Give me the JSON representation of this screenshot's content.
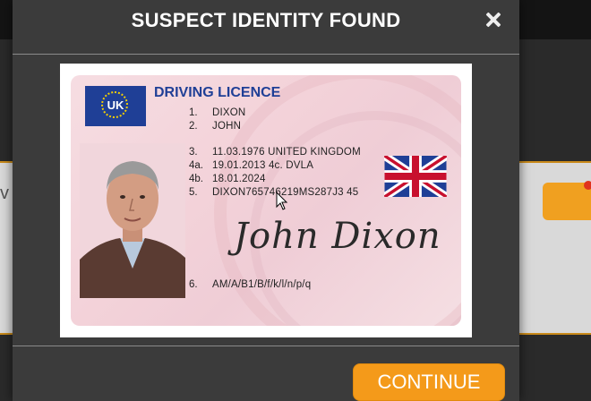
{
  "modal": {
    "title": "SUSPECT IDENTITY FOUND",
    "continue_label": "CONTINUE"
  },
  "background": {
    "left_partial_text": "v"
  },
  "licence": {
    "header": "DRIVING LICENCE",
    "country_code": "UK",
    "fields": [
      {
        "num": "1.",
        "value": "DIXON"
      },
      {
        "num": "2.",
        "value": "JOHN"
      },
      {
        "num": "3.",
        "value": "11.03.1976 UNITED KINGDOM"
      },
      {
        "num": "4a.",
        "value": "19.01.2013 4c. DVLA"
      },
      {
        "num": "4b.",
        "value": "18.01.2024"
      },
      {
        "num": "5.",
        "value": "DIXON765746219MS287J3 45"
      },
      {
        "num": "6.",
        "value": "AM/A/B1/B/f/k/l/n/p/q"
      }
    ],
    "signature": "John Dixon"
  },
  "colors": {
    "modal_bg": "#3b3b3b",
    "accent": "#f49a1a",
    "licence_blue": "#1f3f96"
  },
  "icons": [
    "close-icon",
    "eu-flag-icon",
    "union-jack-icon",
    "mouse-pointer-icon"
  ]
}
